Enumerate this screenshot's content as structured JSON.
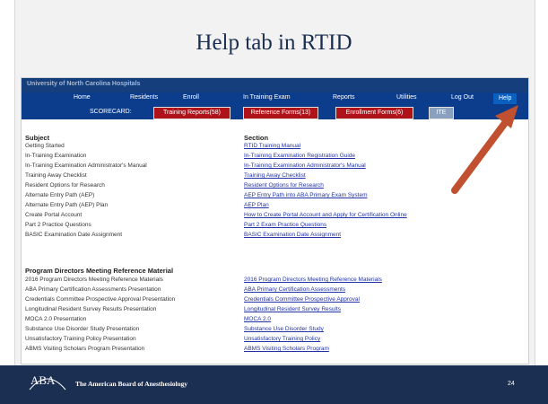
{
  "slide": {
    "title": "Help tab in RTID",
    "page_number": "24"
  },
  "app": {
    "brand": "University of North Carolina Hospitals"
  },
  "nav": {
    "items": [
      "Home",
      "Residents",
      "Enroll",
      "In Training Exam",
      "Reports",
      "Utilities",
      "Log Out",
      "Help"
    ]
  },
  "scorecard": {
    "label": "SCORECARD:",
    "buttons": [
      "Training Reports(58)",
      "Reference Forms(13)",
      "Enrollment Forms(6)",
      "ITE"
    ]
  },
  "content": {
    "subject_header": "Subject",
    "section_header": "Section",
    "subjects": [
      "Getting Started",
      "In-Training Examination",
      "In-Training Examination Administrator's Manual",
      "Training Away Checklist",
      "Resident Options for Research",
      "Alternate Entry Path (AEP)",
      "Alternate Entry Path (AEP) Plan",
      "Create Portal Account",
      "Part 2 Practice Questions",
      "BASIC Examination Date Assignment"
    ],
    "sections": [
      "RTID Training Manual",
      "In-Training Examination Registration Guide",
      "In-Training Examination Administrator's Manual",
      "Training Away Checklist",
      "Resident Options for Research",
      "AEP Entry Path into ABA Primary Exam System",
      "AEP Plan",
      "How to Create Portal Account and Apply for Certification Online",
      "Part 2 Exam Practice Questions",
      "BASIC Examination Date Assignment"
    ],
    "pd_header": "Program Directors Meeting Reference Material",
    "pd_subjects": [
      "2016 Program Directors Meeting Reference Materials",
      "ABA Primary Certification Assessments Presentation",
      "Credentials Committee Prospective Approval Presentation",
      "Longitudinal Resident Survey Results Presentation",
      "MOCA 2.0 Presentation",
      "Substance Use Disorder Study Presentation",
      "Unsatisfactory Training Policy Presentation",
      "ABMS Visiting Scholars Program Presentation"
    ],
    "pd_sections": [
      "2016 Program Directors Meeting Reference Materials",
      "ABA Primary Certification Assessments",
      "Credentials Committee Prospective Approval",
      "Longitudinal Resident Survey Results",
      "MOCA 2.0",
      "Substance Use Disorder Study",
      "Unsatisfactory Training Policy",
      "ABMS Visiting Scholars Program"
    ]
  },
  "footer": {
    "logo": "ABA",
    "org": "The American Board of Anesthesiology"
  },
  "colors": {
    "navy": "#1b2f52",
    "nav_blue": "#0c3d8c",
    "scorecard_red": "#b01219",
    "arrow": "#c0502f",
    "link": "#2233aa"
  }
}
